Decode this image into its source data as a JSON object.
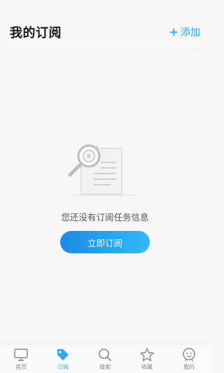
{
  "header": {
    "title": "我的订阅",
    "add_icon": "plus-icon",
    "add_label": "添加",
    "accent_color": "#2aa8f0"
  },
  "empty_state": {
    "illustration": "search-document-icon",
    "message": "您还没有订阅任务信息",
    "button_label": "立即订阅"
  },
  "tabbar": {
    "active_tab": "订阅",
    "items": [
      {
        "label": "首页",
        "icon": "monitor-icon"
      },
      {
        "label": "订阅",
        "icon": "tag-icon"
      },
      {
        "label": "搜索",
        "icon": "search-icon"
      },
      {
        "label": "收藏",
        "icon": "star-icon"
      },
      {
        "label": "我的",
        "icon": "profile-icon"
      }
    ]
  }
}
